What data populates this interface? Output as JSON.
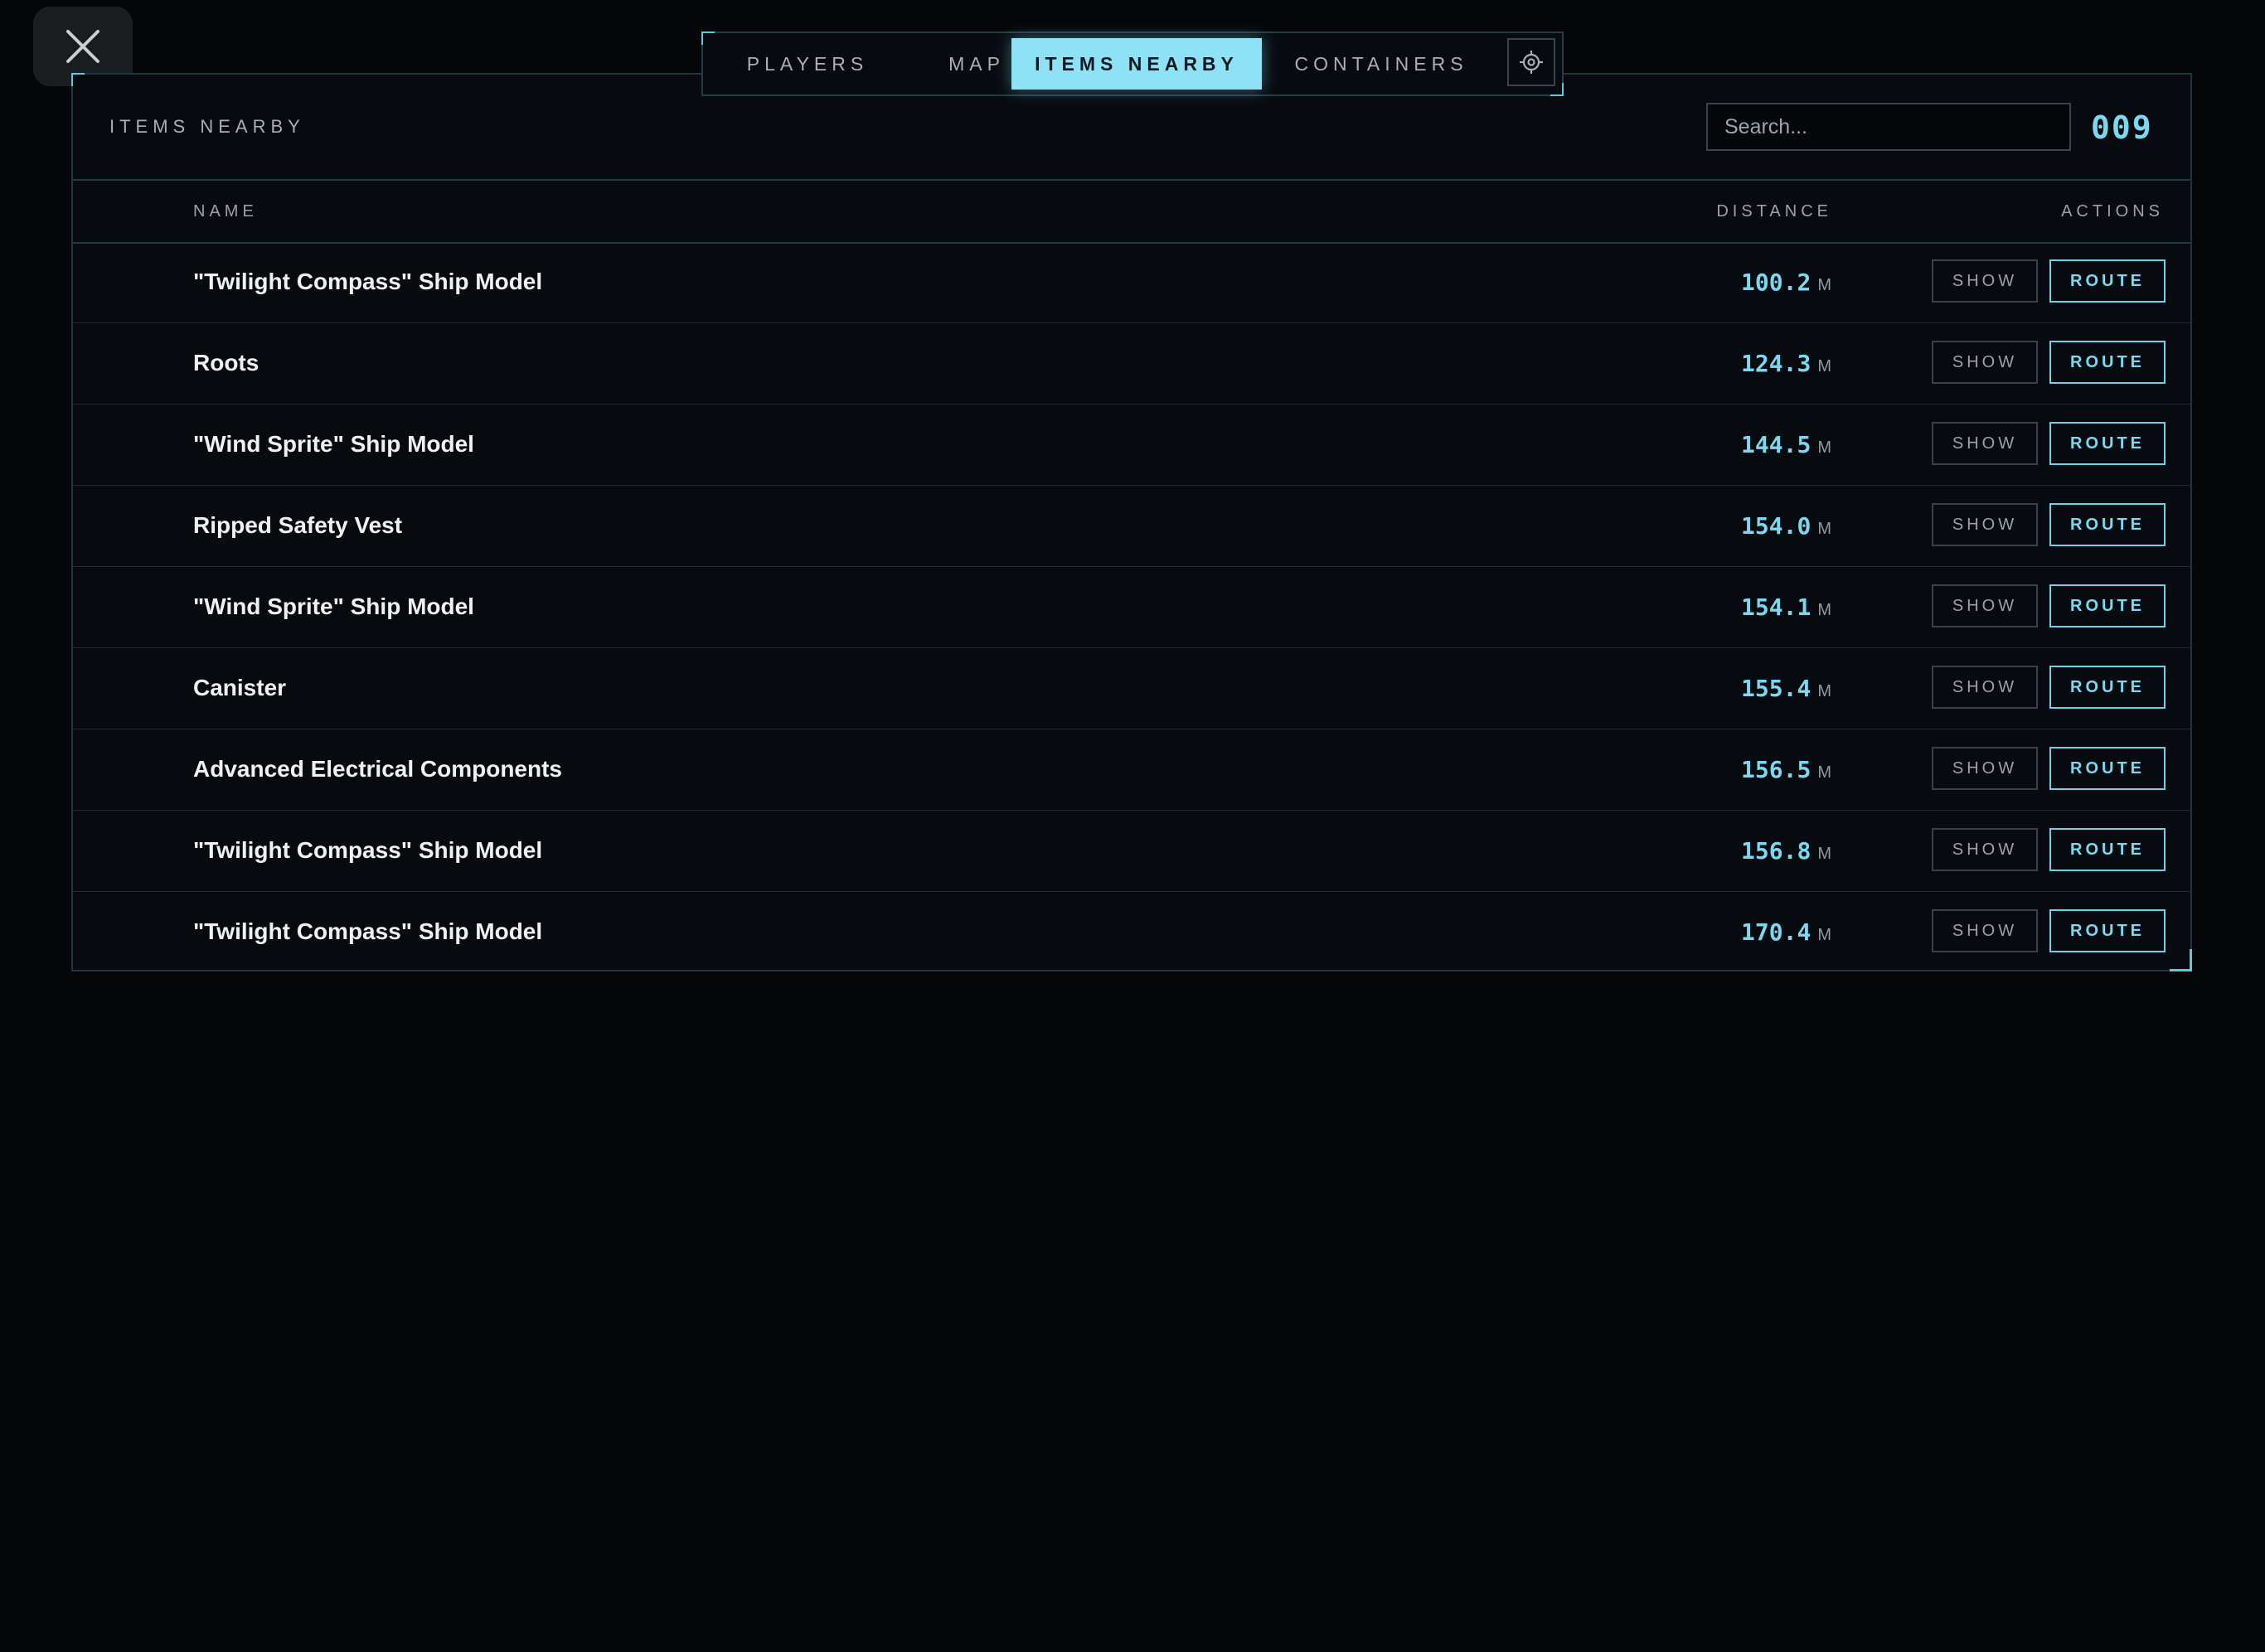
{
  "tabs": {
    "players": "PLAYERS",
    "map": "MAP",
    "items_nearby": "ITEMS NEARBY",
    "containers": "CONTAINERS"
  },
  "icons": {
    "close": "close-icon",
    "target": "target-icon"
  },
  "panel": {
    "title": "ITEMS NEARBY",
    "search_placeholder": "Search...",
    "count": "009"
  },
  "columns": {
    "name": "NAME",
    "distance": "DISTANCE",
    "actions": "ACTIONS"
  },
  "unit": "M",
  "buttons": {
    "show": "SHOW",
    "route": "ROUTE"
  },
  "items": [
    {
      "name": "\"Twilight Compass\" Ship Model",
      "distance": "100.2"
    },
    {
      "name": "Roots",
      "distance": "124.3"
    },
    {
      "name": "\"Wind Sprite\" Ship Model",
      "distance": "144.5"
    },
    {
      "name": "Ripped Safety Vest",
      "distance": "154.0"
    },
    {
      "name": "\"Wind Sprite\" Ship Model",
      "distance": "154.1"
    },
    {
      "name": "Canister",
      "distance": "155.4"
    },
    {
      "name": "Advanced Electrical Components",
      "distance": "156.5"
    },
    {
      "name": "\"Twilight Compass\" Ship Model",
      "distance": "156.8"
    },
    {
      "name": "\"Twilight Compass\" Ship Model",
      "distance": "170.4"
    }
  ],
  "colors": {
    "accent": "#7ad8ef",
    "active_tab": "#8fe2f6",
    "background": "#040608",
    "panel": "#070b10"
  }
}
